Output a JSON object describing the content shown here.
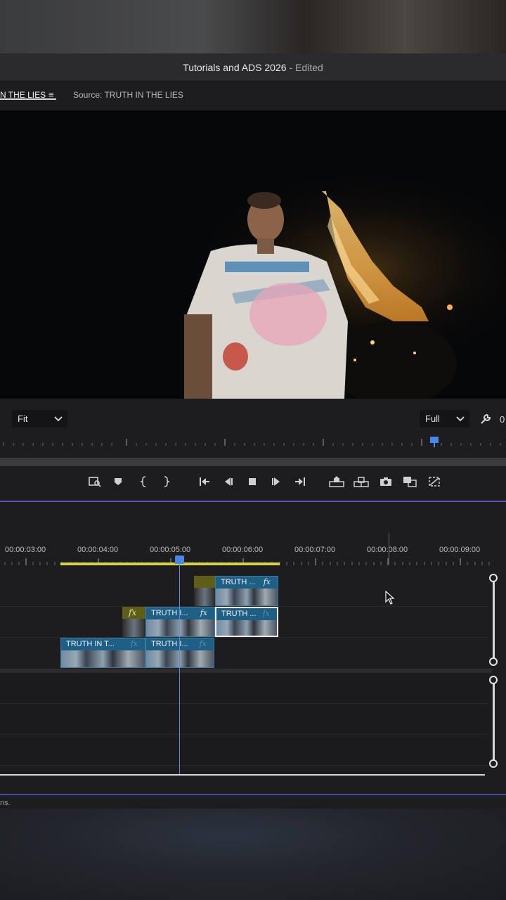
{
  "window": {
    "title": "Tutorials and ADS 2026",
    "title_suffix": "- Edited"
  },
  "tabs": {
    "active_label": "N THE LIES",
    "menu_icon": "hamburger-icon",
    "source_label": "Source: TRUTH IN THE LIES"
  },
  "monitor": {
    "fit_value": "Fit",
    "quality_value": "Full",
    "wrench_icon": "wrench-icon",
    "readout_fragment": "0"
  },
  "transport": {
    "buttons": [
      {
        "name": "export-frame-zoom-icon"
      },
      {
        "name": "add-marker-icon"
      },
      {
        "name": "mark-in-icon"
      },
      {
        "name": "mark-out-icon"
      },
      {
        "name": "go-to-in-icon"
      },
      {
        "name": "step-back-icon"
      },
      {
        "name": "stop-icon"
      },
      {
        "name": "step-forward-icon"
      },
      {
        "name": "go-to-out-icon"
      },
      {
        "name": "lift-icon"
      },
      {
        "name": "extract-icon"
      },
      {
        "name": "export-frame-icon"
      },
      {
        "name": "comparison-view-icon"
      },
      {
        "name": "proxy-toggle-icon"
      }
    ]
  },
  "timeline": {
    "timecodes": [
      "00:00:03:00",
      "00:00:04:00",
      "00:00:05:00",
      "00:00:06:00",
      "00:00:07:00",
      "00:00:08:00",
      "00:00:09:00"
    ],
    "clips": {
      "v3_clip": {
        "name": "TRUTH ...",
        "fx": "fx"
      },
      "v2_clip_a": {
        "name": "TRUTH I...",
        "fx": "fx"
      },
      "v2_clip_b": {
        "name": "TRUTH ...",
        "fx": "fx"
      },
      "v1_clip_a": {
        "name": "TRUTH IN T...",
        "fx": "fx"
      },
      "v1_clip_b": {
        "name": "TRUTH I...",
        "fx": "fx"
      }
    },
    "transition_fx": "fx"
  },
  "status": {
    "text": "ns."
  },
  "colors": {
    "accent_border": "#5a56b8",
    "playhead": "#4a86e8",
    "work_area": "#d8d24a",
    "clip": "#1e5f86"
  }
}
